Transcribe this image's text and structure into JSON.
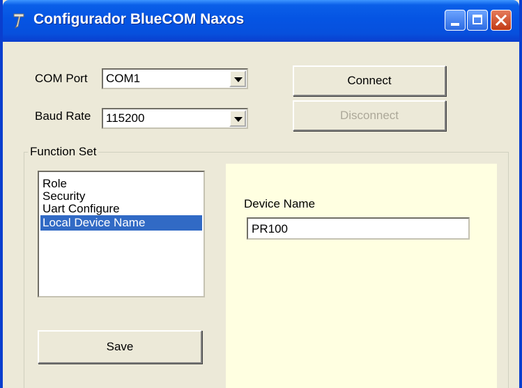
{
  "window": {
    "title": "Configurador BlueCOM Naxos",
    "title_bar_color": "#0A5FE8"
  },
  "connection": {
    "com_port_label": "COM Port",
    "com_port_value": "COM1",
    "baud_rate_label": "Baud Rate",
    "baud_rate_value": "115200",
    "connect_label": "Connect",
    "disconnect_label": "Disconnect"
  },
  "function_set": {
    "legend": "Function Set",
    "items": [
      {
        "label": "Role",
        "selected": false
      },
      {
        "label": "Security",
        "selected": false
      },
      {
        "label": "Uart Configure",
        "selected": false
      },
      {
        "label": "Local Device Name",
        "selected": true
      }
    ],
    "save_label": "Save"
  },
  "device_panel": {
    "label": "Device Name",
    "value": "PR100",
    "background_color": "#FFFFE1"
  },
  "colors": {
    "selection": "#316AC5",
    "window_face": "#ECE9D8"
  }
}
